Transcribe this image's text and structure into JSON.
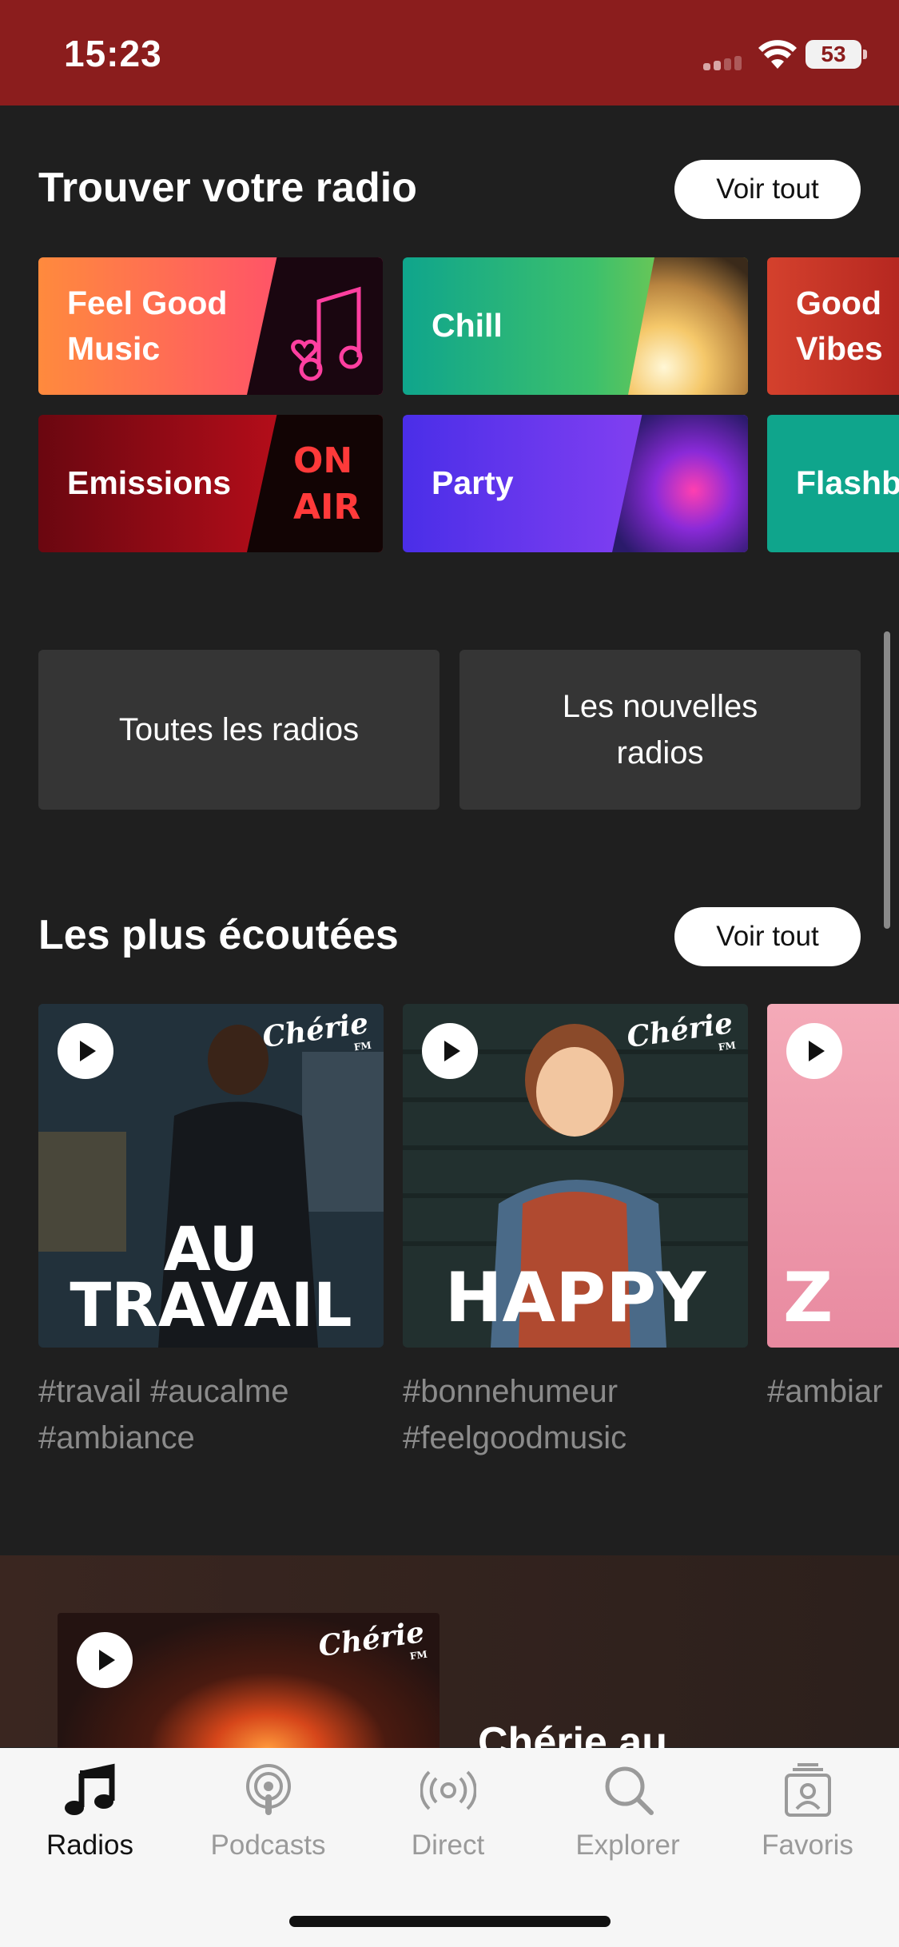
{
  "status_bar": {
    "time": "15:23",
    "battery": "53"
  },
  "find_radio": {
    "title": "Trouver votre radio",
    "see_all": "Voir tout",
    "genres": [
      {
        "label": "Feel Good\nMusic"
      },
      {
        "label": "Chill"
      },
      {
        "label": "Good\nVibes"
      },
      {
        "label": "Emissions"
      },
      {
        "label": "Party"
      },
      {
        "label": "Flashb"
      }
    ]
  },
  "buttons": {
    "all_radios": "Toutes les radios",
    "new_radios": "Les nouvelles\nradios"
  },
  "most_listened": {
    "title": "Les plus écoutées",
    "see_all": "Voir tout",
    "cards": [
      {
        "brand": "Chérie",
        "brand_sub": "FM",
        "big_line1": "AU",
        "big_line2": "TRAVAIL",
        "tags": "#travail #aucalme\n#ambiance"
      },
      {
        "brand": "Chérie",
        "brand_sub": "FM",
        "big_line1": "HAPPY",
        "tags": "#bonnehumeur\n#feelgoodmusic"
      },
      {
        "big_line1": "Z",
        "tags": "#ambiar"
      }
    ]
  },
  "feature": {
    "brand": "Chérie",
    "brand_sub": "FM",
    "title": "Chérie au"
  },
  "tabbar": {
    "tabs": [
      {
        "label": "Radios",
        "icon": "music-note-icon",
        "active": true
      },
      {
        "label": "Podcasts",
        "icon": "podcast-icon"
      },
      {
        "label": "Direct",
        "icon": "broadcast-icon"
      },
      {
        "label": "Explorer",
        "icon": "search-icon"
      },
      {
        "label": "Favoris",
        "icon": "profile-badge-icon"
      }
    ]
  }
}
